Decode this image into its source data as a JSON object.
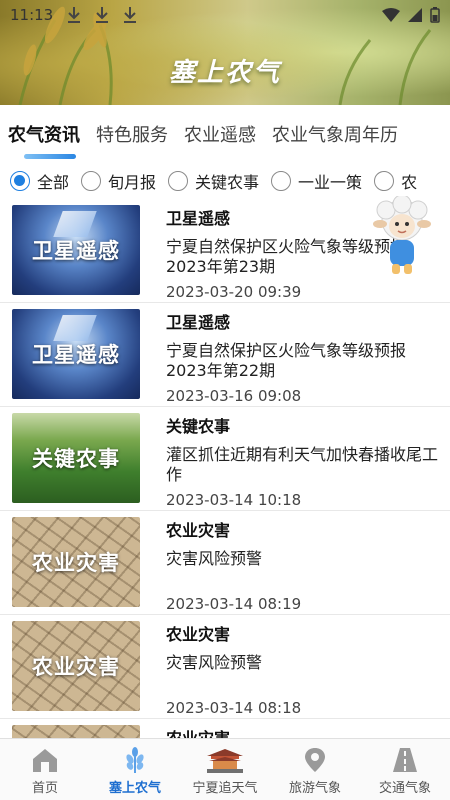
{
  "status_bar": {
    "time": "11:13"
  },
  "banner": {
    "title": "塞上农气"
  },
  "category_tabs": [
    {
      "label": "农气资讯",
      "active": true
    },
    {
      "label": "特色服务",
      "active": false
    },
    {
      "label": "农业遥感",
      "active": false
    },
    {
      "label": "农业气象周年历",
      "active": false
    }
  ],
  "filters": [
    {
      "label": "全部",
      "checked": true
    },
    {
      "label": "旬月报",
      "checked": false
    },
    {
      "label": "关键农事",
      "checked": false
    },
    {
      "label": "一业一策",
      "checked": false
    },
    {
      "label": "农",
      "checked": false
    }
  ],
  "articles": [
    {
      "thumb_text": "卫星遥感",
      "thumb_style": "sat",
      "category": "卫星遥感",
      "summary": "宁夏自然保护区火险气象等级预报2023年第23期",
      "time": "2023-03-20 09:39"
    },
    {
      "thumb_text": "卫星遥感",
      "thumb_style": "sat",
      "category": "卫星遥感",
      "summary": "宁夏自然保护区火险气象等级预报2023年第22期",
      "time": "2023-03-16 09:08"
    },
    {
      "thumb_text": "关键农事",
      "thumb_style": "farm",
      "category": "关键农事",
      "summary": "灌区抓住近期有利天气加快春播收尾工作",
      "time": "2023-03-14 10:18"
    },
    {
      "thumb_text": "农业灾害",
      "thumb_style": "disaster",
      "category": "农业灾害",
      "summary": "灾害风险预警",
      "time": "2023-03-14 08:19"
    },
    {
      "thumb_text": "农业灾害",
      "thumb_style": "disaster",
      "category": "农业灾害",
      "summary": "灾害风险预警",
      "time": "2023-03-14 08:18"
    },
    {
      "thumb_text": "",
      "thumb_style": "disaster",
      "category": "农业灾害",
      "summary": "",
      "time": ""
    }
  ],
  "bottom_nav": [
    {
      "label": "首页",
      "icon": "home-icon",
      "active": false
    },
    {
      "label": "塞上农气",
      "icon": "crop-icon",
      "active": true
    },
    {
      "label": "宁夏追天气",
      "icon": "pavilion-icon",
      "active": false
    },
    {
      "label": "旅游气象",
      "icon": "location-icon",
      "active": false
    },
    {
      "label": "交通气象",
      "icon": "road-icon",
      "active": false
    }
  ],
  "colors": {
    "accent": "#1e7fe0",
    "active_nav": "#1e6fd0"
  }
}
